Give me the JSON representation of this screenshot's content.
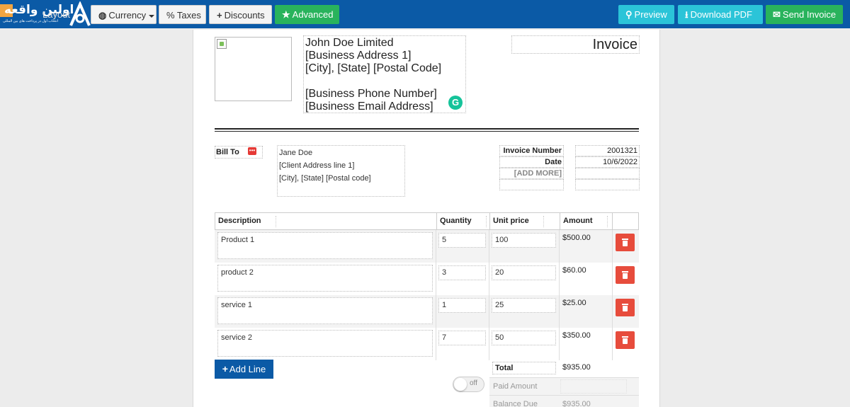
{
  "toolbar": {
    "layout_label": "Layout",
    "currency_label": "Currency",
    "taxes_label": "% Taxes",
    "discounts_label": "Discounts",
    "advanced_label": "Advanced",
    "preview_label": "Preview",
    "download_label": "Download PDF",
    "send_label": "Send Invoice",
    "brand_text": "اولین واقعه",
    "brand_tagline": "انتخاب اول در پرداخت های بین المللی",
    "colors": {
      "bar": "#0b5aa6",
      "green": "#29b35c",
      "cyan": "#2bc4d8",
      "danger": "#e74c3c"
    }
  },
  "business": {
    "name": "John Doe Limited",
    "address1": "[Business Address 1]",
    "city_line": "[City], [State] [Postal Code]",
    "phone": "[Business Phone Number]",
    "email": "[Business Email Address]"
  },
  "invoice_title": "Invoice",
  "bill_to": {
    "label": "Bill To",
    "name": "Jane Doe",
    "address": "[Client Address line 1]",
    "city_line": "[City], [State] [Postal code]"
  },
  "meta": {
    "number_label": "Invoice Number",
    "number_value": "2001321",
    "date_label": "Date",
    "date_value": "10/6/2022",
    "add_more": "[ADD MORE]"
  },
  "table": {
    "headers": {
      "description": "Description",
      "quantity": "Quantity",
      "unit_price": "Unit price",
      "amount": "Amount"
    },
    "rows": [
      {
        "description": "Product 1",
        "quantity": "5",
        "unit_price": "100",
        "amount": "$500.00"
      },
      {
        "description": "product 2",
        "quantity": "3",
        "unit_price": "20",
        "amount": "$60.00"
      },
      {
        "description": "service 1",
        "quantity": "1",
        "unit_price": "25",
        "amount": "$25.00"
      },
      {
        "description": "service 2",
        "quantity": "7",
        "unit_price": "50",
        "amount": "$350.00"
      }
    ]
  },
  "add_line_label": "Add Line",
  "toggle_label": "off",
  "totals": {
    "total_label": "Total",
    "total_value": "$935.00",
    "paid_label": "Paid Amount",
    "balance_label": "Balance Due",
    "balance_value": "$935.00"
  }
}
